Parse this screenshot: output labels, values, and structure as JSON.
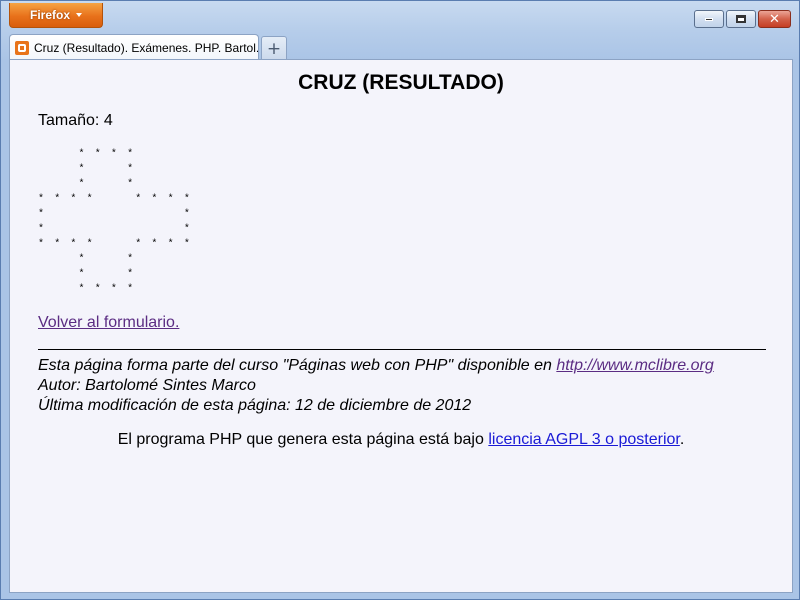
{
  "browser": {
    "menu_label": "Firefox",
    "tab_title": "Cruz (Resultado). Exámenes. PHP. Bartol...",
    "new_tab_symbol": "+"
  },
  "page": {
    "heading": "CRUZ (RESULTADO)",
    "size_label": "Tamaño: 4",
    "cross_art": "     * * * *\n     *     *\n     *     *\n* * * *     * * * *\n*                 *\n*                 *\n* * * *     * * * *\n     *     *\n     *     *\n     * * * *",
    "back_link": "Volver al formulario.",
    "footer_line1_prefix": "Esta página forma parte del curso \"Páginas web con PHP\" disponible en ",
    "footer_line1_link": "http://www.mclibre.org",
    "footer_line2": "Autor: Bartolomé Sintes Marco",
    "footer_line3": "Última modificación de esta página: 12 de diciembre de 2012",
    "license_prefix": "El programa PHP que genera esta página está bajo ",
    "license_link": "licencia AGPL 3 o posterior",
    "license_suffix": "."
  },
  "colors": {
    "firefox_button": "#e8711b",
    "page_background": "#f4f4fb",
    "visited_link": "#5b2c83",
    "link": "#1a1ad6"
  }
}
